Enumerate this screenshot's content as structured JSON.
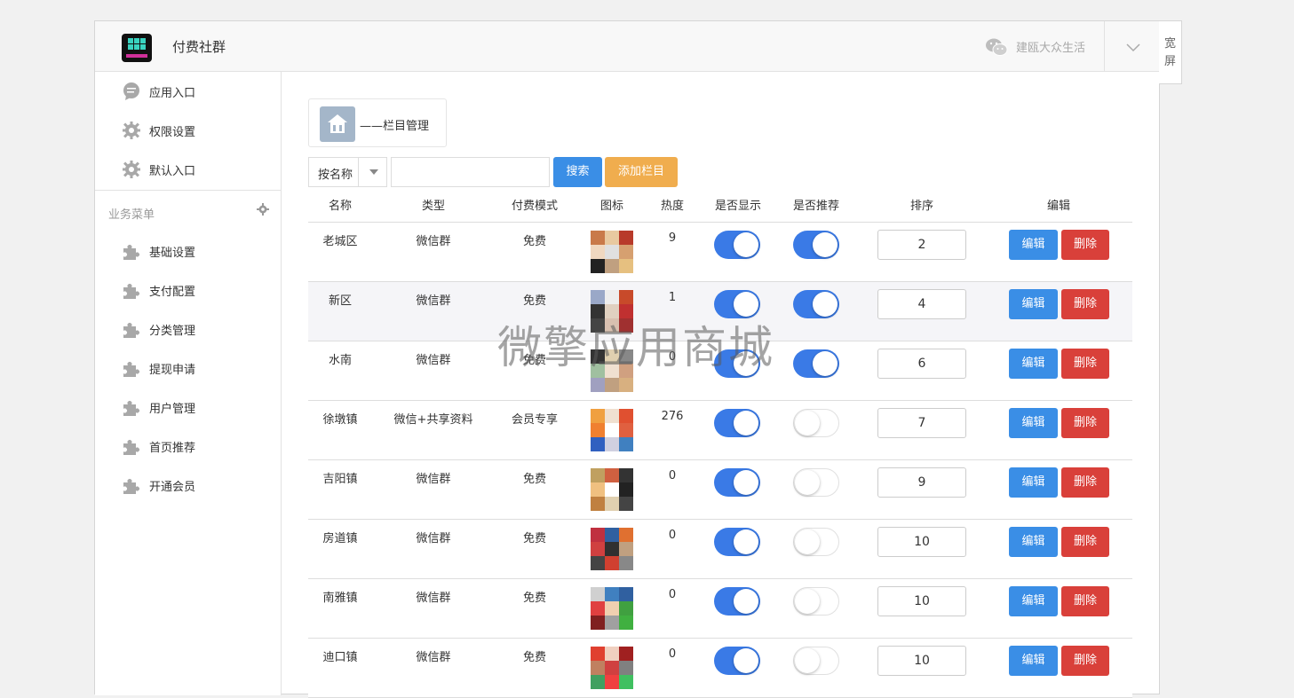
{
  "header": {
    "app_title": "付费社群",
    "account_name": "建瓯大众生活",
    "widescreen_label": "宽屏"
  },
  "sidebar": {
    "top_items": [
      {
        "label": "应用入口",
        "icon": "chat-bubble-icon"
      },
      {
        "label": "权限设置",
        "icon": "gear-icon"
      },
      {
        "label": "默认入口",
        "icon": "gear-icon"
      }
    ],
    "section_title": "业务菜单",
    "menu_items": [
      {
        "label": "基础设置",
        "icon": "puzzle-icon"
      },
      {
        "label": "支付配置",
        "icon": "puzzle-icon"
      },
      {
        "label": "分类管理",
        "icon": "puzzle-icon"
      },
      {
        "label": "提现申请",
        "icon": "puzzle-icon"
      },
      {
        "label": "用户管理",
        "icon": "puzzle-icon"
      },
      {
        "label": "首页推荐",
        "icon": "puzzle-icon"
      },
      {
        "label": "开通会员",
        "icon": "puzzle-icon"
      }
    ]
  },
  "module": {
    "label": "——栏目管理"
  },
  "search": {
    "filter_value": "按名称",
    "query": "",
    "search_button": "搜索",
    "add_button": "添加栏目"
  },
  "table": {
    "headers": {
      "name": "名称",
      "type": "类型",
      "pay_mode": "付费模式",
      "icon": "图标",
      "heat": "热度",
      "show": "是否显示",
      "recommend": "是否推荐",
      "sort": "排序",
      "edit": "编辑"
    },
    "edit_label": "编辑",
    "delete_label": "删除",
    "rows": [
      {
        "name": "老城区",
        "type": "微信群",
        "pay_mode": "免费",
        "heat": "9",
        "show": true,
        "recommend": true,
        "sort": "2"
      },
      {
        "name": "新区",
        "type": "微信群",
        "pay_mode": "免费",
        "heat": "1",
        "show": true,
        "recommend": true,
        "sort": "4"
      },
      {
        "name": "水南",
        "type": "微信群",
        "pay_mode": "免费",
        "heat": "0",
        "show": true,
        "recommend": true,
        "sort": "6"
      },
      {
        "name": "徐墩镇",
        "type": "微信+共享资料",
        "pay_mode": "会员专享",
        "heat": "276",
        "show": true,
        "recommend": false,
        "sort": "7"
      },
      {
        "name": "吉阳镇",
        "type": "微信群",
        "pay_mode": "免费",
        "heat": "0",
        "show": true,
        "recommend": false,
        "sort": "9"
      },
      {
        "name": "房道镇",
        "type": "微信群",
        "pay_mode": "免费",
        "heat": "0",
        "show": true,
        "recommend": false,
        "sort": "10"
      },
      {
        "name": "南雅镇",
        "type": "微信群",
        "pay_mode": "免费",
        "heat": "0",
        "show": true,
        "recommend": false,
        "sort": "10"
      },
      {
        "name": "迪口镇",
        "type": "微信群",
        "pay_mode": "免费",
        "heat": "0",
        "show": true,
        "recommend": false,
        "sort": "10"
      }
    ]
  },
  "watermark": "微擎应用商城",
  "colors": {
    "primary": "#3a8ee6",
    "warning": "#f0ad4e",
    "danger": "#d9403a",
    "toggle_on": "#3a7ae6"
  }
}
